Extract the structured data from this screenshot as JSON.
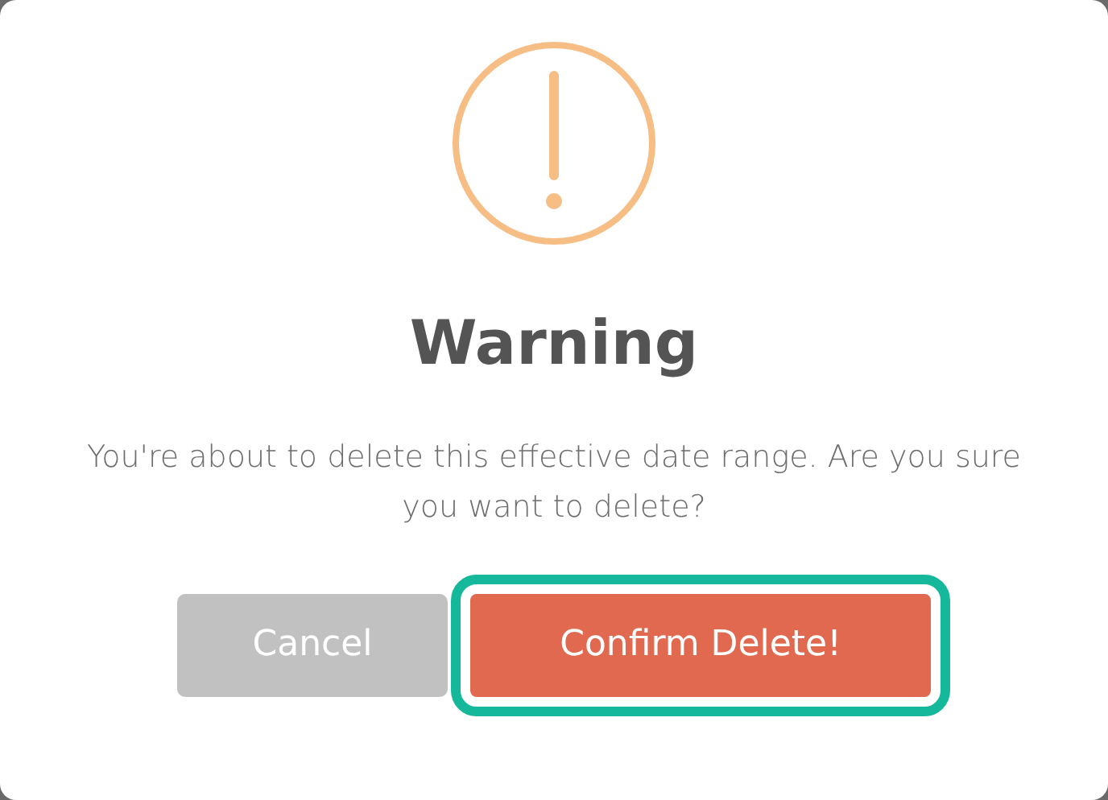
{
  "dialog": {
    "title": "Warning",
    "message": "You're about to delete this effective date range. Are you sure you want to delete?",
    "buttons": [
      {
        "label": "Cancel",
        "kind": "cancel",
        "highlighted": false
      },
      {
        "label": "Confirm Delete!",
        "kind": "danger",
        "highlighted": true
      }
    ]
  }
}
